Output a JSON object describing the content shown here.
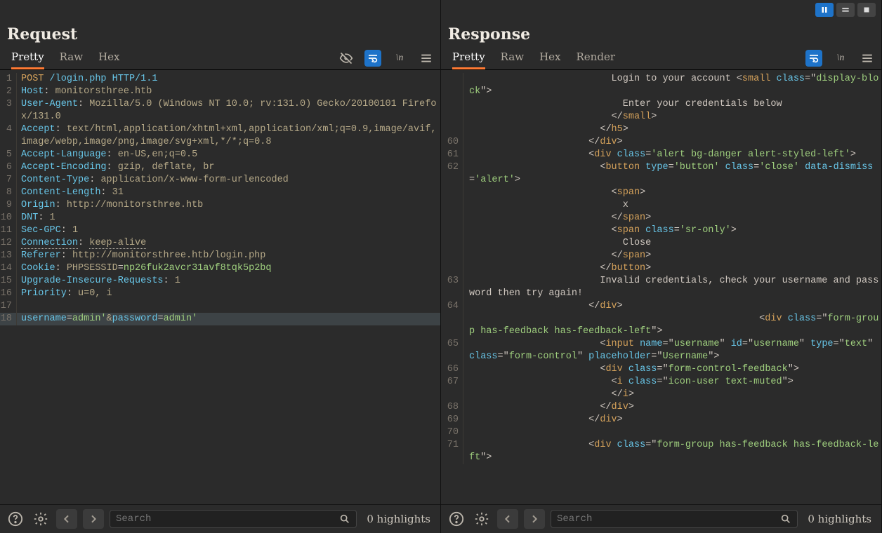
{
  "topbar": {
    "pause_icon": "pause-icon",
    "equals_icon": "equals-icon",
    "stop_icon": "stop-icon"
  },
  "tools": {
    "eye_off": "eye-off-icon",
    "wrap": "wrap-lines-icon",
    "newline": "\\n",
    "menu": "menu-icon",
    "help": "help-icon",
    "gear": "gear-icon",
    "back": "back-icon",
    "fwd": "forward-icon",
    "search": "search-icon"
  },
  "request": {
    "title": "Request",
    "tabs": [
      "Pretty",
      "Raw",
      "Hex"
    ],
    "active_tab": 0,
    "search_placeholder": "Search",
    "highlight_text": "0 highlights",
    "text_lines": [
      {
        "n": 1,
        "segs": [
          [
            "s",
            "POST"
          ],
          [
            "",
            ", "
          ],
          [
            "k",
            "/login.php"
          ],
          [
            "",
            " "
          ],
          [
            "k",
            "HTTP/1.1"
          ]
        ],
        "raw": "POST /login.php HTTP/1.1"
      },
      {
        "n": 2,
        "segs": [
          [
            "k",
            "Host"
          ],
          [
            "",
            ":"
          ],
          [
            "",
            " "
          ],
          [
            "v",
            "monitorsthree.htb"
          ]
        ]
      },
      {
        "n": 3,
        "segs": [
          [
            "k",
            "User-Agent"
          ],
          [
            "",
            ":"
          ],
          [
            "",
            " "
          ],
          [
            "v",
            "Mozilla/5.0 (Windows NT 10.0; rv:131.0) Gecko/20100101 Firefox/131.0"
          ]
        ]
      },
      {
        "n": 4,
        "segs": [
          [
            "k",
            "Accept"
          ],
          [
            "",
            ":"
          ],
          [
            "",
            " "
          ],
          [
            "v",
            "text/html,application/xhtml+xml,application/xml;q=0.9,image/avif,image/webp,image/png,image/svg+xml,*/*;q=0.8"
          ]
        ]
      },
      {
        "n": 5,
        "segs": [
          [
            "k",
            "Accept-Language"
          ],
          [
            "",
            ":"
          ],
          [
            "",
            " "
          ],
          [
            "v",
            "en-US,en;q=0.5"
          ]
        ]
      },
      {
        "n": 6,
        "segs": [
          [
            "k",
            "Accept-Encoding"
          ],
          [
            "",
            ":"
          ],
          [
            "",
            " "
          ],
          [
            "v",
            "gzip, deflate, br"
          ]
        ]
      },
      {
        "n": 7,
        "segs": [
          [
            "k",
            "Content-Type"
          ],
          [
            "",
            ":"
          ],
          [
            "",
            " "
          ],
          [
            "v",
            "application/x-www-form-urlencoded"
          ]
        ]
      },
      {
        "n": 8,
        "segs": [
          [
            "k",
            "Content-Length"
          ],
          [
            "",
            ":"
          ],
          [
            "",
            " "
          ],
          [
            "v",
            "31"
          ]
        ]
      },
      {
        "n": 9,
        "segs": [
          [
            "k",
            "Origin"
          ],
          [
            "",
            ":"
          ],
          [
            "",
            " "
          ],
          [
            "v",
            "http://monitorsthree.htb"
          ]
        ]
      },
      {
        "n": 10,
        "segs": [
          [
            "k",
            "DNT"
          ],
          [
            "",
            ":"
          ],
          [
            "",
            " "
          ],
          [
            "v",
            "1"
          ]
        ]
      },
      {
        "n": 11,
        "segs": [
          [
            "k",
            "Sec-GPC"
          ],
          [
            "",
            ":"
          ],
          [
            "",
            " "
          ],
          [
            "v",
            "1"
          ]
        ]
      },
      {
        "n": 12,
        "segs": [
          [
            "k dotund",
            "Connection"
          ],
          [
            "",
            ":"
          ],
          [
            "",
            " "
          ],
          [
            "v dotund",
            "keep-alive"
          ]
        ]
      },
      {
        "n": 13,
        "segs": [
          [
            "k",
            "Referer"
          ],
          [
            "",
            ":"
          ],
          [
            "",
            " "
          ],
          [
            "v",
            "http://monitorsthree.htb/login.php"
          ]
        ]
      },
      {
        "n": 14,
        "segs": [
          [
            "k",
            "Cookie"
          ],
          [
            "",
            ":"
          ],
          [
            "",
            " "
          ],
          [
            "v",
            "PHPSESSID"
          ],
          [
            "",
            "="
          ],
          [
            "gr",
            "np26fuk2avcr31avf8tqk5p2bq"
          ]
        ]
      },
      {
        "n": 15,
        "segs": [
          [
            "k",
            "Upgrade-Insecure-Requests"
          ],
          [
            "",
            ":"
          ],
          [
            "",
            " "
          ],
          [
            "v",
            "1"
          ]
        ]
      },
      {
        "n": 16,
        "segs": [
          [
            "k",
            "Priority"
          ],
          [
            "",
            ":"
          ],
          [
            "",
            " "
          ],
          [
            "v",
            "u=0, i"
          ]
        ]
      },
      {
        "n": 17,
        "segs": [
          [
            "",
            ""
          ]
        ]
      },
      {
        "n": 18,
        "hl": true,
        "segs": [
          [
            "k",
            "username"
          ],
          [
            "",
            "="
          ],
          [
            "gr",
            "admin'"
          ],
          [
            "v",
            "&"
          ],
          [
            "k",
            "password"
          ],
          [
            "",
            "="
          ],
          [
            "gr",
            "admin'"
          ]
        ]
      }
    ]
  },
  "response": {
    "title": "Response",
    "tabs": [
      "Pretty",
      "Raw",
      "Hex",
      "Render"
    ],
    "active_tab": 0,
    "search_placeholder": "Search",
    "highlight_text": "0 highlights",
    "text_lines": [
      {
        "n": "",
        "segs": [
          [
            "",
            "                         Login to your account <"
          ],
          [
            "s",
            "small"
          ],
          [
            "",
            " "
          ],
          [
            "k",
            "class"
          ],
          [
            "",
            "=\""
          ],
          [
            "gr",
            "display-block"
          ],
          [
            "",
            "\">"
          ]
        ]
      },
      {
        "n": "",
        "segs": [
          [
            "",
            "                           Enter your credentials below"
          ]
        ]
      },
      {
        "n": "",
        "segs": [
          [
            "",
            "                         </"
          ],
          [
            "s",
            "small"
          ],
          [
            "",
            ">"
          ]
        ]
      },
      {
        "n": "",
        "segs": [
          [
            "",
            "                       </"
          ],
          [
            "s",
            "h5"
          ],
          [
            "",
            ">"
          ]
        ]
      },
      {
        "n": 60,
        "segs": [
          [
            "",
            "                     </"
          ],
          [
            "s",
            "div"
          ],
          [
            "",
            ">"
          ]
        ]
      },
      {
        "n": 61,
        "segs": [
          [
            "",
            "                     <"
          ],
          [
            "s",
            "div"
          ],
          [
            "",
            " "
          ],
          [
            "k",
            "class"
          ],
          [
            "",
            "="
          ],
          [
            "gr",
            "'alert bg-danger alert-styled-left'"
          ],
          [
            "",
            ">"
          ]
        ]
      },
      {
        "n": 62,
        "segs": [
          [
            "",
            "                       <"
          ],
          [
            "s",
            "button"
          ],
          [
            "",
            " "
          ],
          [
            "k",
            "type"
          ],
          [
            "",
            "="
          ],
          [
            "gr",
            "'button'"
          ],
          [
            "",
            " "
          ],
          [
            "k",
            "class"
          ],
          [
            "",
            "="
          ],
          [
            "gr",
            "'close'"
          ],
          [
            "",
            " "
          ],
          [
            "k",
            "data-dismiss"
          ],
          [
            "",
            "="
          ],
          [
            "gr",
            "'alert'"
          ],
          [
            "",
            ">"
          ]
        ]
      },
      {
        "n": "",
        "segs": [
          [
            "",
            "                         <"
          ],
          [
            "s",
            "span"
          ],
          [
            "",
            ">"
          ]
        ]
      },
      {
        "n": "",
        "segs": [
          [
            "",
            "                           x"
          ]
        ]
      },
      {
        "n": "",
        "segs": [
          [
            "",
            "                         </"
          ],
          [
            "s",
            "span"
          ],
          [
            "",
            ">"
          ]
        ]
      },
      {
        "n": "",
        "segs": [
          [
            "",
            "                         <"
          ],
          [
            "s",
            "span"
          ],
          [
            "",
            " "
          ],
          [
            "k",
            "class"
          ],
          [
            "",
            "="
          ],
          [
            "gr",
            "'sr-only'"
          ],
          [
            "",
            ">"
          ]
        ]
      },
      {
        "n": "",
        "segs": [
          [
            "",
            "                           Close"
          ]
        ]
      },
      {
        "n": "",
        "segs": [
          [
            "",
            "                         </"
          ],
          [
            "s",
            "span"
          ],
          [
            "",
            ">"
          ]
        ]
      },
      {
        "n": "",
        "segs": [
          [
            "",
            "                       </"
          ],
          [
            "s",
            "button"
          ],
          [
            "",
            ">"
          ]
        ]
      },
      {
        "n": 63,
        "segs": [
          [
            "",
            "                       Invalid credentials, check your username and password then try again!"
          ]
        ]
      },
      {
        "n": 64,
        "segs": [
          [
            "",
            "                     </"
          ],
          [
            "s",
            "div"
          ],
          [
            "",
            ">"
          ]
        ]
      },
      {
        "n": "",
        "segs": [
          [
            "",
            "                                                   <"
          ],
          [
            "s",
            "div"
          ],
          [
            "",
            " "
          ],
          [
            "k",
            "class"
          ],
          [
            "",
            "=\""
          ],
          [
            "gr",
            "form-group has-feedback has-feedback-left"
          ],
          [
            "",
            "\">"
          ]
        ]
      },
      {
        "n": 65,
        "segs": [
          [
            "",
            "                       <"
          ],
          [
            "s",
            "input"
          ],
          [
            "",
            " "
          ],
          [
            "k",
            "name"
          ],
          [
            "",
            "=\""
          ],
          [
            "gr",
            "username"
          ],
          [
            "",
            "\" "
          ],
          [
            "k",
            "id"
          ],
          [
            "",
            "=\""
          ],
          [
            "gr",
            "username"
          ],
          [
            "",
            "\" "
          ],
          [
            "k",
            "type"
          ],
          [
            "",
            "=\""
          ],
          [
            "gr",
            "text"
          ],
          [
            "",
            "\" "
          ],
          [
            "k",
            "class"
          ],
          [
            "",
            "=\""
          ],
          [
            "gr",
            "form-control"
          ],
          [
            "",
            "\" "
          ],
          [
            "k",
            "placeholder"
          ],
          [
            "",
            "=\""
          ],
          [
            "gr",
            "Username"
          ],
          [
            "",
            "\">"
          ]
        ]
      },
      {
        "n": 66,
        "segs": [
          [
            "",
            "                       <"
          ],
          [
            "s",
            "div"
          ],
          [
            "",
            " "
          ],
          [
            "k",
            "class"
          ],
          [
            "",
            "=\""
          ],
          [
            "gr",
            "form-control-feedback"
          ],
          [
            "",
            "\">"
          ]
        ]
      },
      {
        "n": 67,
        "segs": [
          [
            "",
            "                         <"
          ],
          [
            "s",
            "i"
          ],
          [
            "",
            " "
          ],
          [
            "k",
            "class"
          ],
          [
            "",
            "=\""
          ],
          [
            "gr",
            "icon-user text-muted"
          ],
          [
            "",
            "\">"
          ]
        ]
      },
      {
        "n": "",
        "segs": [
          [
            "",
            "                         </"
          ],
          [
            "s",
            "i"
          ],
          [
            "",
            ">"
          ]
        ]
      },
      {
        "n": 68,
        "segs": [
          [
            "",
            "                       </"
          ],
          [
            "s",
            "div"
          ],
          [
            "",
            ">"
          ]
        ]
      },
      {
        "n": 69,
        "segs": [
          [
            "",
            "                     </"
          ],
          [
            "s",
            "div"
          ],
          [
            "",
            ">"
          ]
        ]
      },
      {
        "n": 70,
        "segs": [
          [
            "",
            ""
          ]
        ]
      },
      {
        "n": 71,
        "segs": [
          [
            "",
            "                     <"
          ],
          [
            "s",
            "div"
          ],
          [
            "",
            " "
          ],
          [
            "k",
            "class"
          ],
          [
            "",
            "=\""
          ],
          [
            "gr",
            "form-group has-feedback has-feedback-left"
          ],
          [
            "",
            "\">"
          ]
        ]
      }
    ]
  }
}
